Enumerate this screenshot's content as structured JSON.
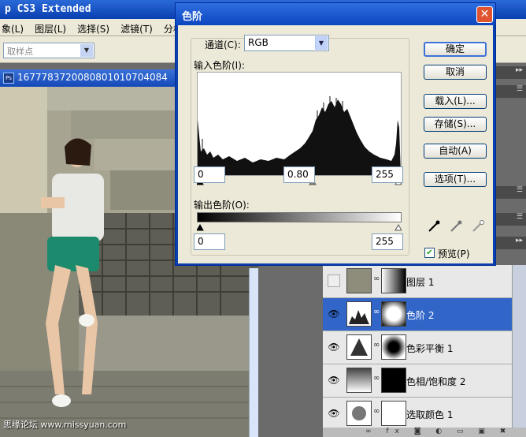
{
  "app": {
    "title": "p CS3 Extended",
    "menu": [
      "象(L)",
      "图层(L)",
      "选择(S)",
      "滤镜(T)",
      "分析"
    ],
    "sample_select": "取样点",
    "document_title": "1677783720080801010704084",
    "watermark": "思缘论坛 www.missyuan.com",
    "panel_strips": [
      "▸▸",
      "☰",
      "☰",
      "☰",
      "▸▸"
    ]
  },
  "dialog": {
    "title": "色阶",
    "close": "✕",
    "channel_label": "通道(C):",
    "channel_value": "RGB",
    "input_levels_label": "输入色阶(I):",
    "input_black": "0",
    "input_gamma": "0.80",
    "input_white": "255",
    "output_levels_label": "输出色阶(O):",
    "output_black": "0",
    "output_white": "255",
    "buttons": {
      "ok": "确定",
      "cancel": "取消",
      "load": "载入(L)...",
      "save": "存储(S)...",
      "auto": "自动(A)",
      "options": "选项(T)..."
    },
    "preview_label": "预览(P)",
    "preview_checked": true
  },
  "layers": [
    {
      "name": "图层 1",
      "visible": false,
      "selected": false
    },
    {
      "name": "色阶 2",
      "visible": true,
      "selected": true
    },
    {
      "name": "色彩平衡 1",
      "visible": true,
      "selected": false
    },
    {
      "name": "色相/饱和度 2",
      "visible": true,
      "selected": false
    },
    {
      "name": "选取颜色 1",
      "visible": true,
      "selected": false
    }
  ],
  "layer_footer_icons": "∞ fx ◙ ◐ ▭ ▣ ✖",
  "colors": {
    "titlebar": "#0a3fb0",
    "selected_layer": "#3166c8",
    "dialog_bg": "#ece9d8"
  }
}
